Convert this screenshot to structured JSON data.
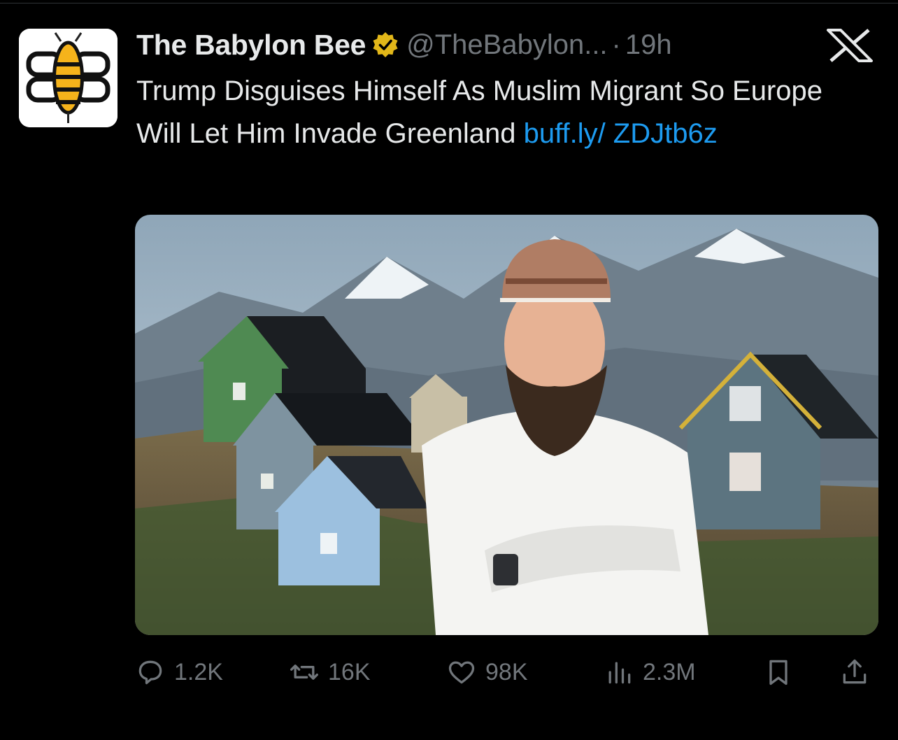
{
  "tweet": {
    "display_name": "The Babylon Bee",
    "handle": "@TheBabylon...",
    "separator": "·",
    "time": "19h",
    "text": "Trump Disguises Himself As Muslim Migrant So Europe Will Let Him Invade Greenland ",
    "link": "buff.ly/ ZDJtb6z"
  },
  "actions": {
    "replies": "1.2K",
    "reposts": "16K",
    "likes": "98K",
    "views": "2.3M"
  },
  "icons": {
    "verified": "verified-gold-badge-icon",
    "close": "x-logo-icon",
    "reply": "reply-icon",
    "repost": "repost-icon",
    "like": "heart-icon",
    "views": "views-icon",
    "bookmark": "bookmark-icon",
    "share": "share-icon"
  },
  "colors": {
    "background": "#000000",
    "text": "#e7e9ea",
    "muted": "#71767b",
    "link": "#1d9bf0",
    "verified": "#e2b719"
  }
}
